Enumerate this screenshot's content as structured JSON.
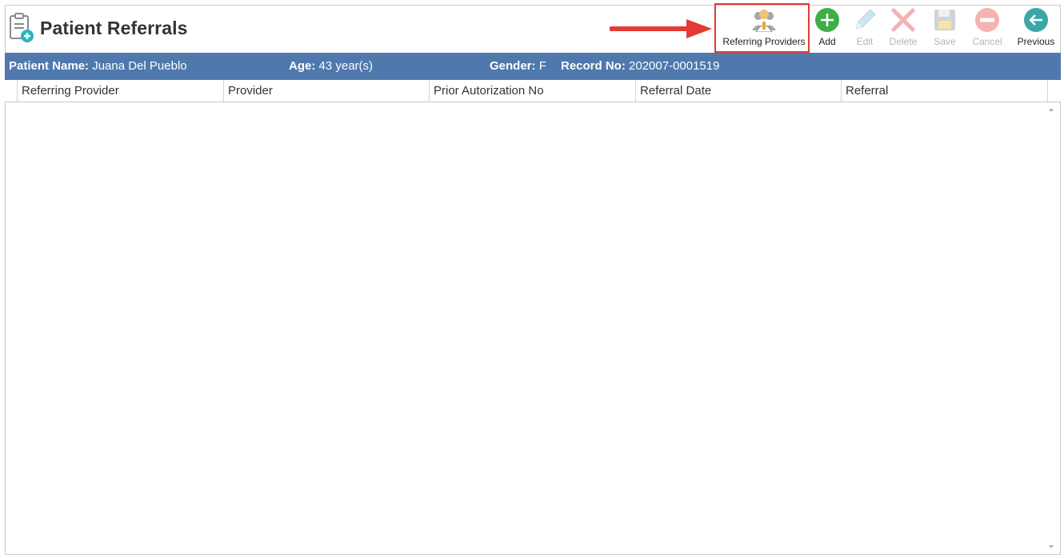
{
  "page": {
    "title": "Patient Referrals",
    "title_icon": "clipboard-add-icon"
  },
  "toolbar": {
    "referring_providers": "Referring Providers",
    "add": "Add",
    "edit": "Edit",
    "delete": "Delete",
    "save": "Save",
    "cancel": "Cancel",
    "previous": "Previous"
  },
  "patient": {
    "name_label": "Patient Name:",
    "name_value": "Juana Del Pueblo",
    "age_label": "Age:",
    "age_value": "43 year(s)",
    "gender_label": "Gender:",
    "gender_value": "F",
    "record_label": "Record No:",
    "record_value": "202007-0001519"
  },
  "grid": {
    "columns": [
      "Referring Provider",
      "Provider",
      "Prior Autorization No",
      "Referral Date",
      "Referral"
    ],
    "rows": []
  },
  "colors": {
    "header_bar": "#4f78ad",
    "highlight": "#e53935",
    "add_green": "#3fae49",
    "previous_teal": "#3aa6a6"
  }
}
